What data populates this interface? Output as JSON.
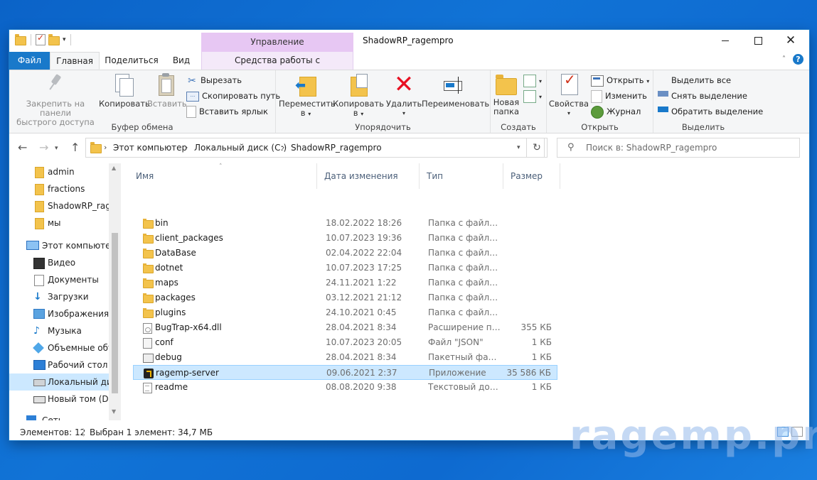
{
  "titlebar": {
    "context_group": "Управление",
    "window_title": "ShadowRP_ragempro",
    "minimize": "",
    "maximize": "",
    "close": "✕"
  },
  "tabs": {
    "file": "Файл",
    "home": "Главная",
    "share": "Поделиться",
    "view": "Вид",
    "app_tools": "Средства работы с приложениями"
  },
  "ribbon": {
    "clipboard": {
      "group_label": "Буфер обмена",
      "pin_line1": "Закрепить на панели",
      "pin_line2": "быстрого доступа",
      "copy": "Копировать",
      "paste": "Вставить",
      "cut": "Вырезать",
      "copy_path": "Скопировать путь",
      "paste_shortcut": "Вставить ярлык"
    },
    "organize": {
      "group_label": "Упорядочить",
      "move_line1": "Переместить",
      "move_line2": "в",
      "copy_line1": "Копировать",
      "copy_line2": "в",
      "delete": "Удалить",
      "rename": "Переименовать"
    },
    "new": {
      "group_label": "Создать",
      "new_folder_line1": "Новая",
      "new_folder_line2": "папка"
    },
    "open": {
      "group_label": "Открыть",
      "properties": "Свойства",
      "open": "Открыть",
      "edit": "Изменить",
      "history": "Журнал"
    },
    "select": {
      "group_label": "Выделить",
      "select_all": "Выделить все",
      "select_none": "Снять выделение",
      "invert": "Обратить выделение"
    }
  },
  "address": {
    "crumbs": [
      "Этот компьютер",
      "Локальный диск (C:)",
      "ShadowRP_ragempro"
    ],
    "search_placeholder": "Поиск в: ShadowRP_ragempro"
  },
  "nav": {
    "quick": [
      "admin",
      "fractions",
      "ShadowRP_ragempro",
      "мы"
    ],
    "this_pc": "Этот компьютер",
    "pc_items": [
      "Видео",
      "Документы",
      "Загрузки",
      "Изображения",
      "Музыка",
      "Объемные объекты",
      "Рабочий стол",
      "Локальный диск (C:)",
      "Новый том (D:)"
    ],
    "network": "Сеть"
  },
  "columns": {
    "name": "Имя",
    "date": "Дата изменения",
    "type": "Тип",
    "size": "Размер"
  },
  "files": [
    {
      "name": "bin",
      "date": "18.02.2022 18:26",
      "type": "Папка с файлами",
      "size": "",
      "icon": "folder-icon"
    },
    {
      "name": "client_packages",
      "date": "10.07.2023 19:36",
      "type": "Папка с файлами",
      "size": "",
      "icon": "folder-icon"
    },
    {
      "name": "DataBase",
      "date": "02.04.2022 22:04",
      "type": "Папка с файлами",
      "size": "",
      "icon": "folder-icon"
    },
    {
      "name": "dotnet",
      "date": "10.07.2023 17:25",
      "type": "Папка с файлами",
      "size": "",
      "icon": "folder-icon"
    },
    {
      "name": "maps",
      "date": "24.11.2021 1:22",
      "type": "Папка с файлами",
      "size": "",
      "icon": "folder-icon"
    },
    {
      "name": "packages",
      "date": "03.12.2021 21:12",
      "type": "Папка с файлами",
      "size": "",
      "icon": "folder-icon"
    },
    {
      "name": "plugins",
      "date": "24.10.2021 0:45",
      "type": "Папка с файлами",
      "size": "",
      "icon": "folder-icon"
    },
    {
      "name": "BugTrap-x64.dll",
      "date": "28.04.2021 8:34",
      "type": "Расширение приложения",
      "size": "355 КБ",
      "icon": "dll-icon"
    },
    {
      "name": "conf",
      "date": "10.07.2023 20:05",
      "type": "Файл \"JSON\"",
      "size": "1 КБ",
      "icon": "json-file-icon"
    },
    {
      "name": "debug",
      "date": "28.04.2021 8:34",
      "type": "Пакетный файл Windows",
      "size": "1 КБ",
      "icon": "batch-file-icon"
    },
    {
      "name": "ragemp-server",
      "date": "09.06.2021 2:37",
      "type": "Приложение",
      "size": "35 586 КБ",
      "icon": "ragemp-app-icon"
    },
    {
      "name": "readme",
      "date": "08.08.2020 9:38",
      "type": "Текстовый документ",
      "size": "1 КБ",
      "icon": "text-file-icon"
    }
  ],
  "status": {
    "items": "Элементов: 12",
    "selected": "Выбран 1 элемент: 34,7 МБ"
  },
  "watermark": "ragemp.pro",
  "colors": {
    "accent": "#1979ca",
    "selection": "#cce8ff",
    "context_tab": "#e7c7f3",
    "desktop": "#0e6ad0"
  }
}
